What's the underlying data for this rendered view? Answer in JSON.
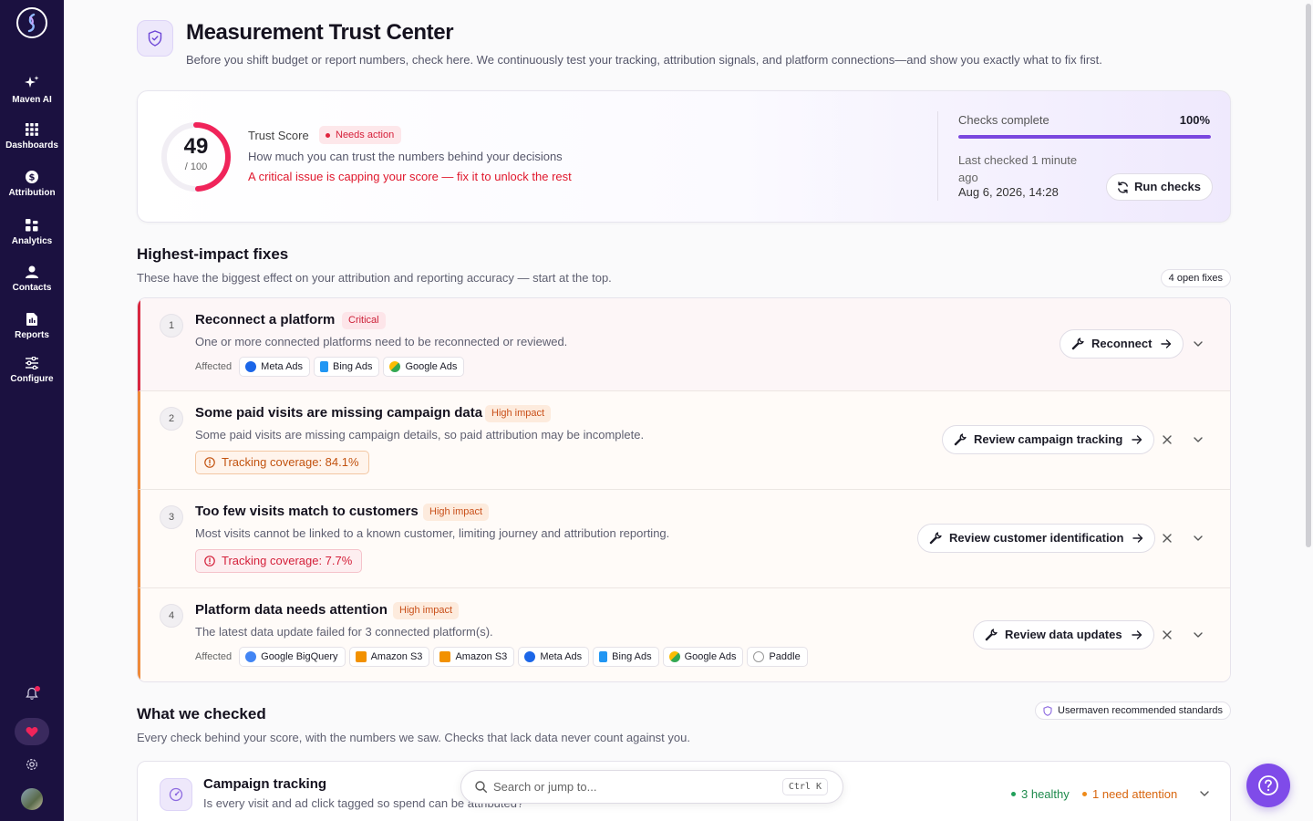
{
  "sidebar": {
    "items": [
      {
        "label": "Maven AI",
        "icon": "sparkles-icon"
      },
      {
        "label": "Dashboards",
        "icon": "grid-icon"
      },
      {
        "label": "Attribution",
        "icon": "dollar-icon"
      },
      {
        "label": "Analytics",
        "icon": "bar-chart-icon"
      },
      {
        "label": "Contacts",
        "icon": "person-icon"
      },
      {
        "label": "Reports",
        "icon": "document-icon"
      },
      {
        "label": "Configure",
        "icon": "sliders-icon"
      }
    ]
  },
  "header": {
    "title": "Measurement Trust Center",
    "subtitle": "Before you shift budget or report numbers, check here. We continuously test your tracking, attribution signals, and platform connections—and show you exactly what to fix first."
  },
  "trust": {
    "score": "49",
    "score_denominator": "/ 100",
    "score_fraction": 0.49,
    "label": "Trust Score",
    "status": "Needs action",
    "description": "How much you can trust the numbers behind your decisions",
    "critical_note": "A critical issue is capping your score — fix it to unlock the rest",
    "checks_label": "Checks complete",
    "checks_pct": "100%",
    "checks_fraction": 1.0,
    "last_checked": "Last checked 1 minute ago",
    "last_date": "Aug 6, 2026, 14:28",
    "run_button": "Run checks"
  },
  "fixes_section": {
    "title": "Highest-impact fixes",
    "subtitle": "These have the biggest effect on your attribution and reporting accuracy — start at the top.",
    "count_badge": "4 open fixes",
    "affected_label": "Affected",
    "items": [
      {
        "num": "1",
        "title": "Reconnect a platform",
        "badge": "Critical",
        "desc": "One or more connected platforms need to be reconnected or reviewed.",
        "action": "Reconnect",
        "affected": [
          "Meta Ads",
          "Bing Ads",
          "Google Ads"
        ]
      },
      {
        "num": "2",
        "title": "Some paid visits are missing campaign data",
        "badge": "High impact",
        "desc": "Some paid visits are missing campaign details, so paid attribution may be incomplete.",
        "coverage": "Tracking coverage: 84.1%",
        "action": "Review campaign tracking"
      },
      {
        "num": "3",
        "title": "Too few visits match to customers",
        "badge": "High impact",
        "desc": "Most visits cannot be linked to a known customer, limiting journey and attribution reporting.",
        "coverage": "Tracking coverage: 7.7%",
        "action": "Review customer identification"
      },
      {
        "num": "4",
        "title": "Platform data needs attention",
        "badge": "High impact",
        "desc": "The latest data update failed for 3 connected platform(s).",
        "action": "Review data updates",
        "affected": [
          "Google BigQuery",
          "Amazon S3",
          "Amazon S3",
          "Meta Ads",
          "Bing Ads",
          "Google Ads",
          "Paddle"
        ]
      }
    ]
  },
  "checked_section": {
    "title": "What we checked",
    "subtitle": "Every check behind your score, with the numbers we saw. Checks that lack data never count against you.",
    "standards_badge": "Usermaven recommended standards",
    "card": {
      "title": "Campaign tracking",
      "subtitle": "Is every visit and ad click tagged so spend can be attributed?",
      "healthy": "3 healthy",
      "attention": "1 need attention"
    }
  },
  "search": {
    "placeholder": "Search or jump to...",
    "shortcut": "Ctrl K"
  },
  "colors": {
    "accent": "#7f4be9",
    "critical": "#d8273f",
    "high": "#ee8a3a",
    "sidebar": "#1b1140"
  }
}
